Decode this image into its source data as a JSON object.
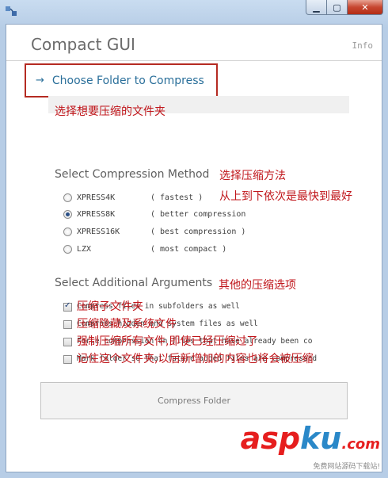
{
  "window": {
    "app_title": "Compact GUI",
    "info_link": "Info"
  },
  "choose_folder": {
    "arrow_glyph": "→",
    "label": "Choose Folder to Compress"
  },
  "compression_method": {
    "heading": "Select Compression Method",
    "options": [
      {
        "name": "XPRESS4K",
        "desc": "( fastest )",
        "selected": false
      },
      {
        "name": "XPRESS8K",
        "desc": "( better compression",
        "selected": true
      },
      {
        "name": "XPRESS16K",
        "desc": "( best compression )",
        "selected": false
      },
      {
        "name": "LZX",
        "desc": "( most compact )",
        "selected": false
      }
    ]
  },
  "additional_arguments": {
    "heading": "Select Additional Arguments",
    "options": [
      {
        "label": "Compress files in subfolders as well",
        "checked": true
      },
      {
        "label": "Compress hidden and system files as well",
        "checked": false
      },
      {
        "label": "Force compression on files that have already been co",
        "checked": false
      },
      {
        "label": "Mark folder so that future added files are compressed",
        "checked": false
      }
    ]
  },
  "compress_button": {
    "label": "Compress Folder"
  },
  "annotations": {
    "choose_folder": "选择想要压缩的文件夹",
    "method": "选择压缩方法",
    "method_order": "从上到下依次是最快到最好",
    "arguments": "其他的压缩选项",
    "subfolders": "压缩子文件夹",
    "hidden_system": "压缩隐藏及系统文件",
    "force": "强制压缩所有文件,即使已经压缩过了",
    "mark_folder": "记住这个文件夹,以后新增加的内容也将会被压缩"
  },
  "watermark": {
    "brand_a": "asp",
    "brand_b": "ku",
    "brand_c": ".com",
    "tagline": "免费网站源码下载站!"
  },
  "colors": {
    "annotation": "#c0161b",
    "link_blue": "#2a6f9a",
    "highlight_border": "#b52b22"
  }
}
